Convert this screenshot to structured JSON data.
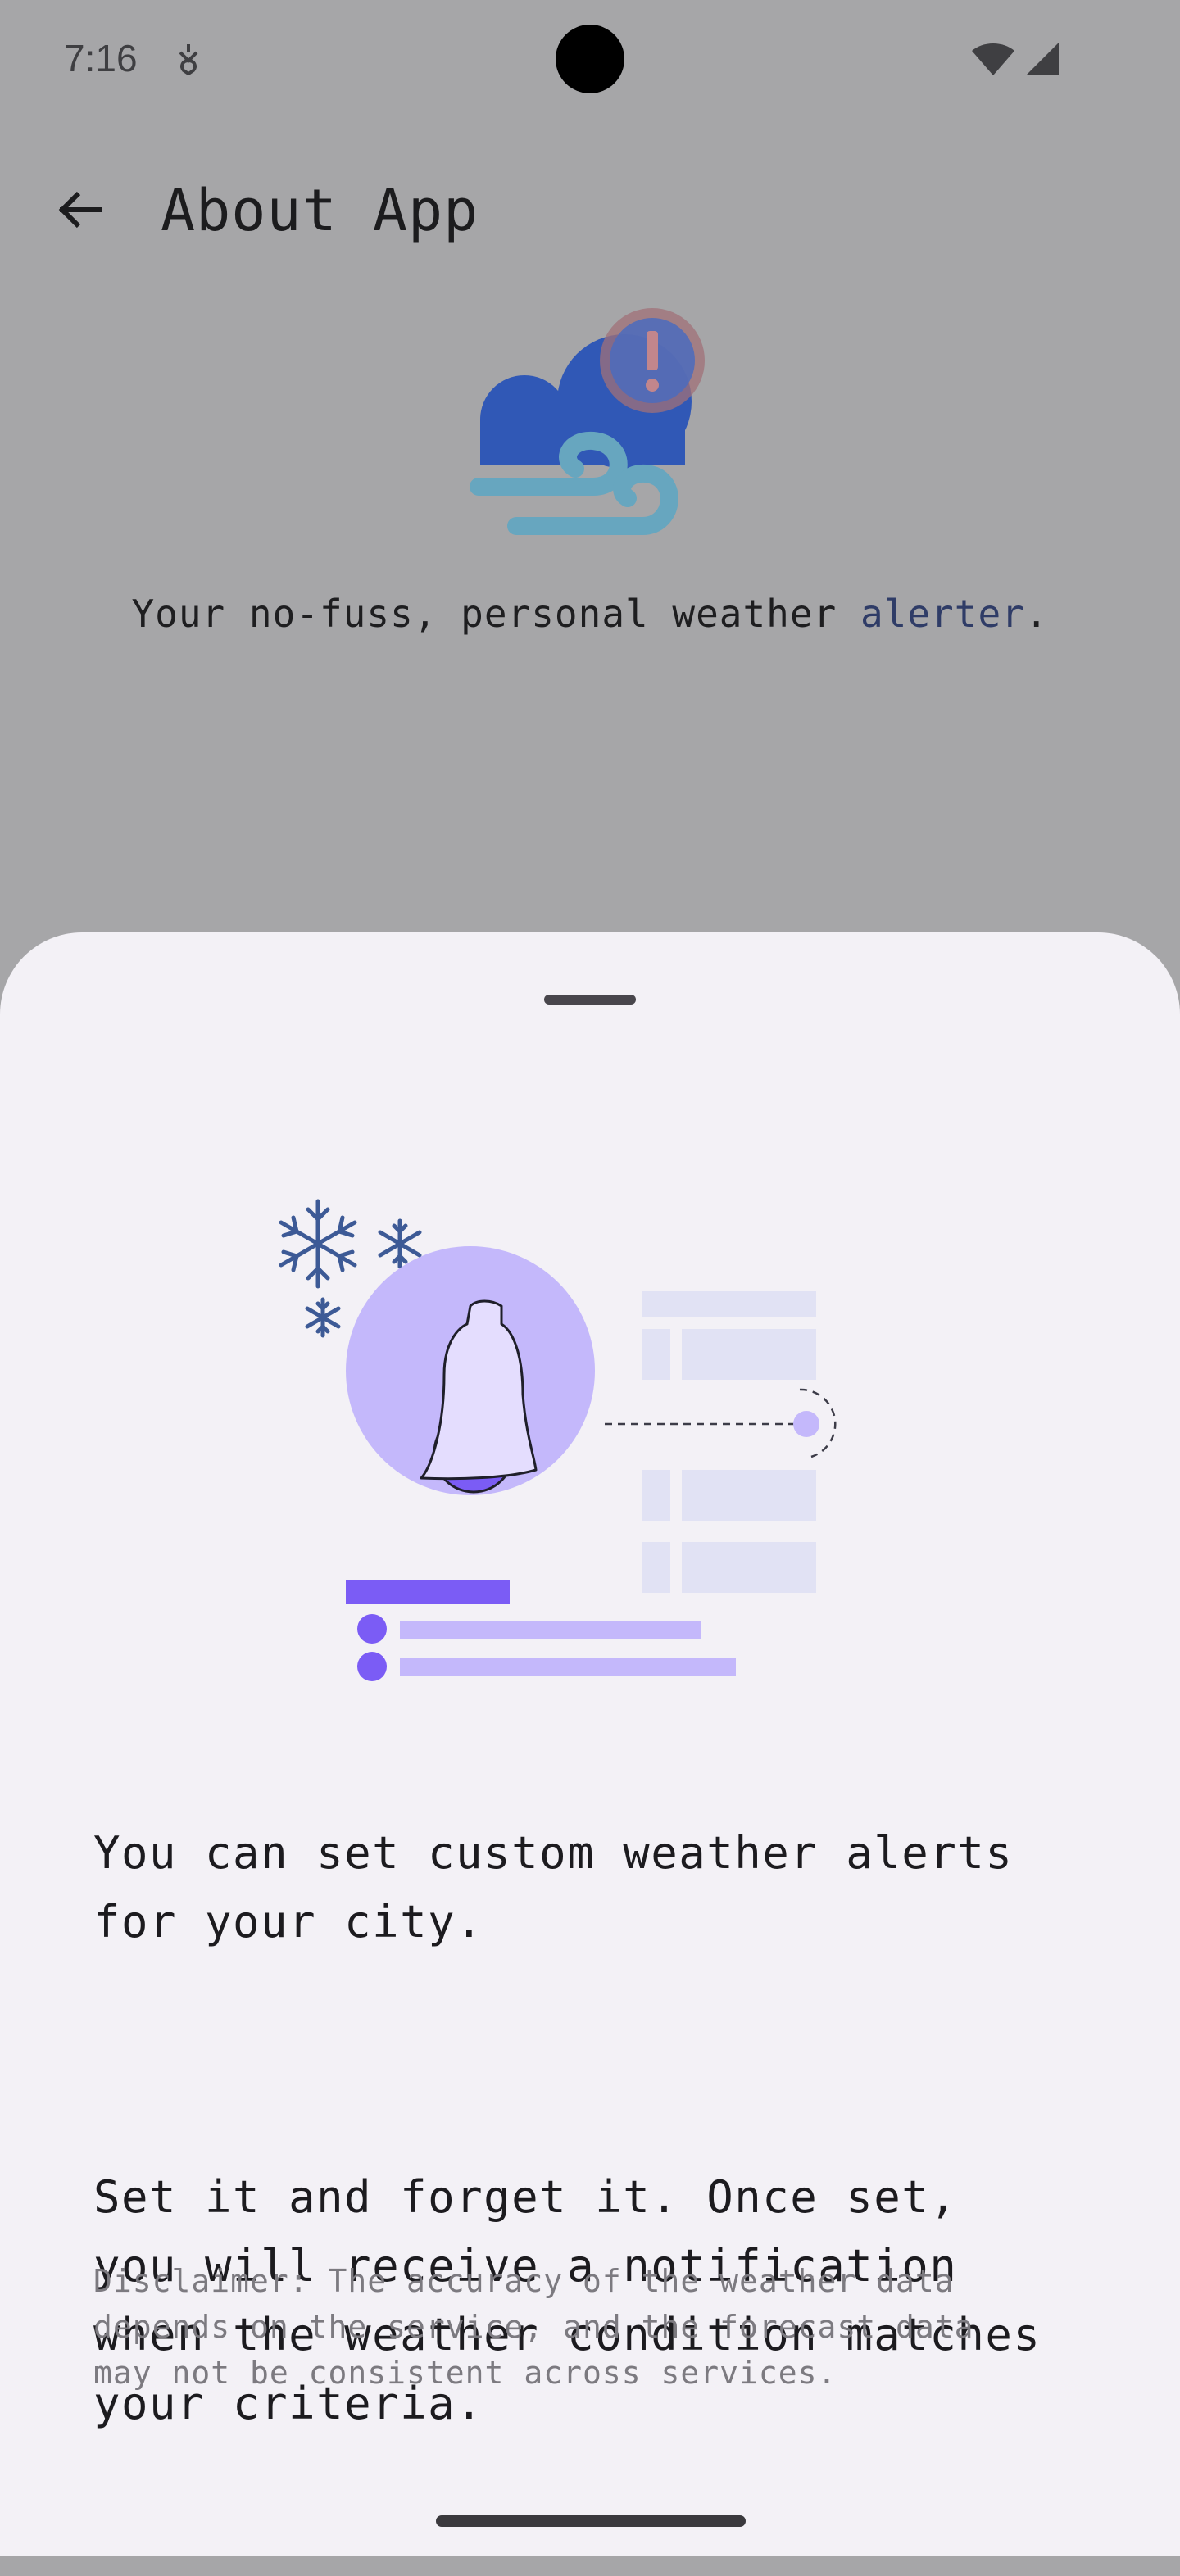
{
  "status_bar": {
    "time": "7:16",
    "icons": [
      "notification-icon",
      "wifi-icon",
      "signal-icon"
    ]
  },
  "app_bar": {
    "back_icon": "arrow-back-icon",
    "title": "About App"
  },
  "about": {
    "logo_icon": "cloud-wind-alert-icon",
    "tagline_prefix": "Your no-fuss, personal weather ",
    "tagline_accent": "alerter",
    "tagline_suffix": "."
  },
  "sheet": {
    "illustration": "bell-alert-snowflake-illustration",
    "paragraph_1": "You can set custom weather alerts\nfor your city.",
    "paragraph_2": "Set it and forget it. Once set,\nyou will receive a notification\nwhen the weather condition matches\nyour criteria.",
    "disclaimer": "Disclaimer: The accuracy of the weather data\ndepends on the service, and the forecast data\nmay not be consistent across services."
  },
  "colors": {
    "scrim_background": "#a6a6a8",
    "sheet_background": "#f3f1f6",
    "accent_purple": "#7b5cf5",
    "light_purple": "#c4b8fb",
    "tagline_accent": "#2f3c67"
  }
}
